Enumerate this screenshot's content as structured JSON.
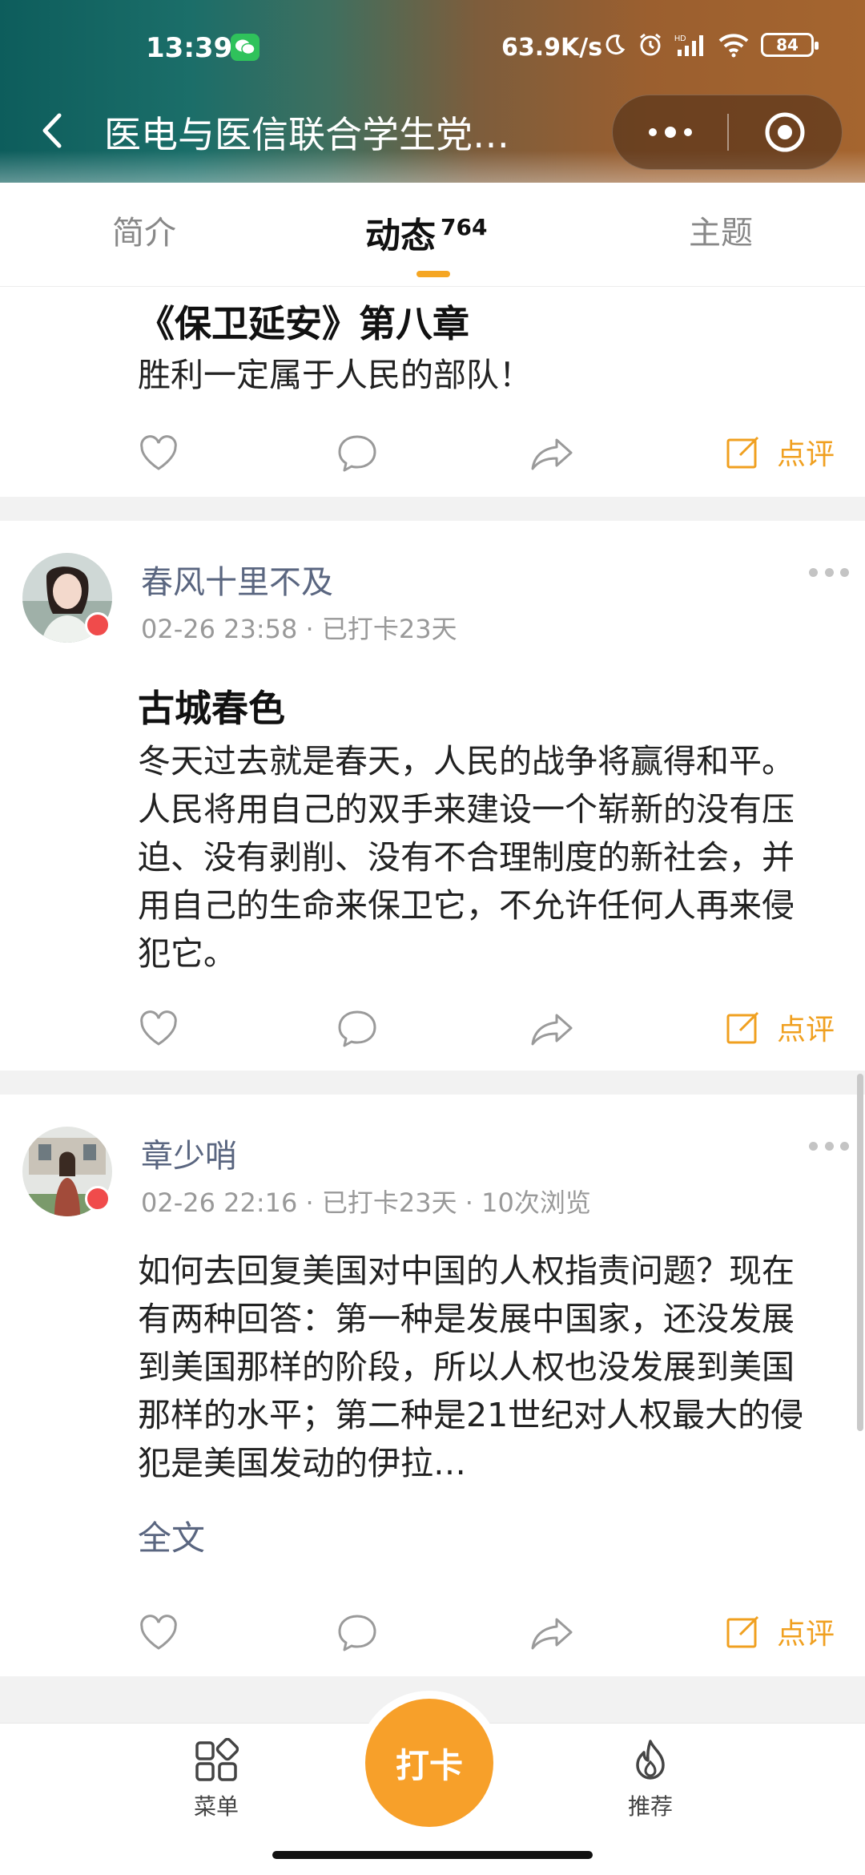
{
  "status_bar": {
    "time": "13:39",
    "net_speed": "63.9K/s",
    "battery": "84"
  },
  "nav": {
    "title": "医电与医信联合学生党…"
  },
  "tabs": [
    {
      "label": "简介"
    },
    {
      "label": "动态",
      "count": "764"
    },
    {
      "label": "主题"
    }
  ],
  "posts": [
    {
      "title": "《保卫延安》第八章",
      "body": "胜利一定属于人民的部队！",
      "review_label": "点评"
    },
    {
      "author": "春风十里不及",
      "meta": "02-26 23:58 · 已打卡23天",
      "title": "古城春色",
      "body": "冬天过去就是春天，人民的战争将赢得和平。人民将用自己的双手来建设一个崭新的没有压迫、没有剥削、没有不合理制度的新社会，并用自己的生命来保卫它，不允许任何人再来侵犯它。",
      "review_label": "点评"
    },
    {
      "author": "章少哨",
      "meta": "02-26 22:16 · 已打卡23天 · 10次浏览",
      "body": "如何去回复美国对中国的人权指责问题？现在有两种回答：第一种是发展中国家，还没发展到美国那样的阶段，所以人权也没发展到美国那样的水平；第二种是21世纪对人权最大的侵犯是美国发动的伊拉…",
      "full_text_label": "全文",
      "review_label": "点评"
    }
  ],
  "bottom_bar": {
    "menu_label": "菜单",
    "checkin_label": "打卡",
    "recommend_label": "推荐"
  },
  "colors": {
    "accent": "#f5a623",
    "link": "#5a6680"
  }
}
